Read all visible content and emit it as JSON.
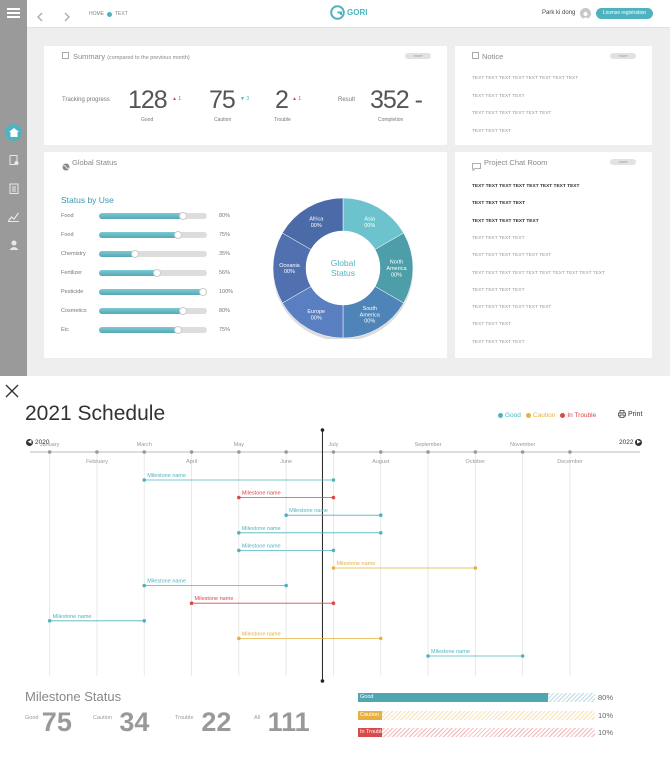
{
  "header": {
    "breadcrumb_home": "HOME",
    "breadcrumb_current": "TEXT",
    "logo": "GORI",
    "user_name": "Park ki dong",
    "license_button": "License registration"
  },
  "summary": {
    "title": "Summary",
    "subtitle": "(compared to the previous month)",
    "more": "more",
    "tracking_label": "Tracking progress",
    "result_label": "Result",
    "good": {
      "value": "128",
      "label": "Good",
      "delta": "1",
      "dir": "up"
    },
    "caution": {
      "value": "75",
      "label": "Caution",
      "delta": "3",
      "dir": "down"
    },
    "trouble": {
      "value": "2",
      "label": "Trouble",
      "delta": "1",
      "dir": "up"
    },
    "completion": {
      "value": "352",
      "label": "Completion",
      "suffix": "-"
    }
  },
  "notice": {
    "title": "Notice",
    "more": "more",
    "items": [
      "TEXT TEXT TEXT TEXT TEXT TEXT TEXT TEXT",
      "TEXT TEXT TEXT TEXT",
      "TEXT TEXT TEXT TEXT TEXT TEXT",
      "TEXT TEXT TEXT"
    ]
  },
  "global_status": {
    "title": "Global Status",
    "status_title": "Status by Use",
    "uses": [
      {
        "label": "Food",
        "percent": 80,
        "text": "80%"
      },
      {
        "label": "Food",
        "percent": 75,
        "text": "75%"
      },
      {
        "label": "Chemistry",
        "percent": 35,
        "text": "35%"
      },
      {
        "label": "Fertilizer",
        "percent": 56,
        "text": "56%"
      },
      {
        "label": "Pesticide",
        "percent": 100,
        "text": "100%"
      },
      {
        "label": "Cosmetics",
        "percent": 80,
        "text": "80%"
      },
      {
        "label": "Etc",
        "percent": 75,
        "text": "75%"
      }
    ],
    "donut_center": [
      "Global",
      "Status"
    ],
    "regions": [
      {
        "name": "Asia",
        "value": "00%",
        "color": "#6cc3cd"
      },
      {
        "name": "North America",
        "value": "00%",
        "color": "#4d9ea8"
      },
      {
        "name": "South America",
        "value": "00%",
        "color": "#4f84b8"
      },
      {
        "name": "Europe",
        "value": "00%",
        "color": "#5a7fc0"
      },
      {
        "name": "Oceania",
        "value": "00%",
        "color": "#5070b0"
      },
      {
        "name": "Africa",
        "value": "00%",
        "color": "#4a6aa8"
      }
    ]
  },
  "chat": {
    "title": "Project Chat Room",
    "more": "more",
    "items": [
      {
        "text": "TEXT TEXT TEXT TEXT TEXT TEXT TEXT TEXT",
        "bold": true
      },
      {
        "text": "TEXT TEXT TEXT TEXT",
        "bold": true
      },
      {
        "text": "TEXT TEXT TEXT TEXT TEXT",
        "bold": true
      },
      {
        "text": "TEXT TEXT TEXT TEXT",
        "bold": false
      },
      {
        "text": "TEXT TEXT TEXT TEXT TEXT TEXT",
        "bold": false
      },
      {
        "text": "TEXT TEXT TEXT TEXT TEXT TEXT TEXT TEXT TEXT TEXT",
        "bold": false
      },
      {
        "text": "TEXT TEXT TEXT TEXT",
        "bold": false
      },
      {
        "text": "TEXT TEXT TEXT TEXT TEXT TEXT",
        "bold": false
      },
      {
        "text": "TEXT TEXT TEXT",
        "bold": false
      },
      {
        "text": "TEXT TEXT TEXT TEXT",
        "bold": false
      }
    ]
  },
  "schedule": {
    "title": "2021 Schedule",
    "legend": [
      {
        "label": "Good",
        "color": "#4fb3bf"
      },
      {
        "label": "Caution",
        "color": "#e8b041"
      },
      {
        "label": "In Trouble",
        "color": "#d94a4a"
      }
    ],
    "print": "Print",
    "prev_year": "2020",
    "next_year": "2022",
    "months": [
      "January",
      "February",
      "March",
      "April",
      "May",
      "June",
      "July",
      "August",
      "September",
      "October",
      "November",
      "December"
    ],
    "current_month": 7,
    "milestones": [
      {
        "label": "Milestone name",
        "start": 3,
        "end": 7,
        "status": "good"
      },
      {
        "label": "Milestone name",
        "start": 5,
        "end": 7,
        "status": "trouble"
      },
      {
        "label": "Milestone name",
        "start": 6,
        "end": 8,
        "status": "good"
      },
      {
        "label": "Milestone name",
        "start": 5,
        "end": 8,
        "status": "good"
      },
      {
        "label": "Milestone name",
        "start": 5,
        "end": 7,
        "status": "good"
      },
      {
        "label": "Milestone name",
        "start": 7,
        "end": 10,
        "status": "caution"
      },
      {
        "label": "Milestone name",
        "start": 3,
        "end": 6,
        "status": "good"
      },
      {
        "label": "Milestone name",
        "start": 4,
        "end": 7,
        "status": "trouble"
      },
      {
        "label": "Milestone name",
        "start": 1,
        "end": 3,
        "status": "good"
      },
      {
        "label": "Milestone name",
        "start": 5,
        "end": 8,
        "status": "caution"
      },
      {
        "label": "Milestone name",
        "start": 9,
        "end": 11,
        "status": "good"
      }
    ]
  },
  "milestone_status": {
    "title": "Milestone Status",
    "counts": [
      {
        "label": "Good",
        "value": "75"
      },
      {
        "label": "Caution",
        "value": "34"
      },
      {
        "label": "Trouble",
        "value": "22"
      },
      {
        "label": "All",
        "value": "111"
      }
    ],
    "bars": [
      {
        "label": "Good",
        "percent": 80,
        "text": "80%",
        "color": "#4fa5b1"
      },
      {
        "label": "Caution",
        "percent": 10,
        "text": "10%",
        "color": "#e8b041"
      },
      {
        "label": "In Trouble",
        "percent": 10,
        "text": "10%",
        "color": "#d94a4a"
      }
    ]
  }
}
